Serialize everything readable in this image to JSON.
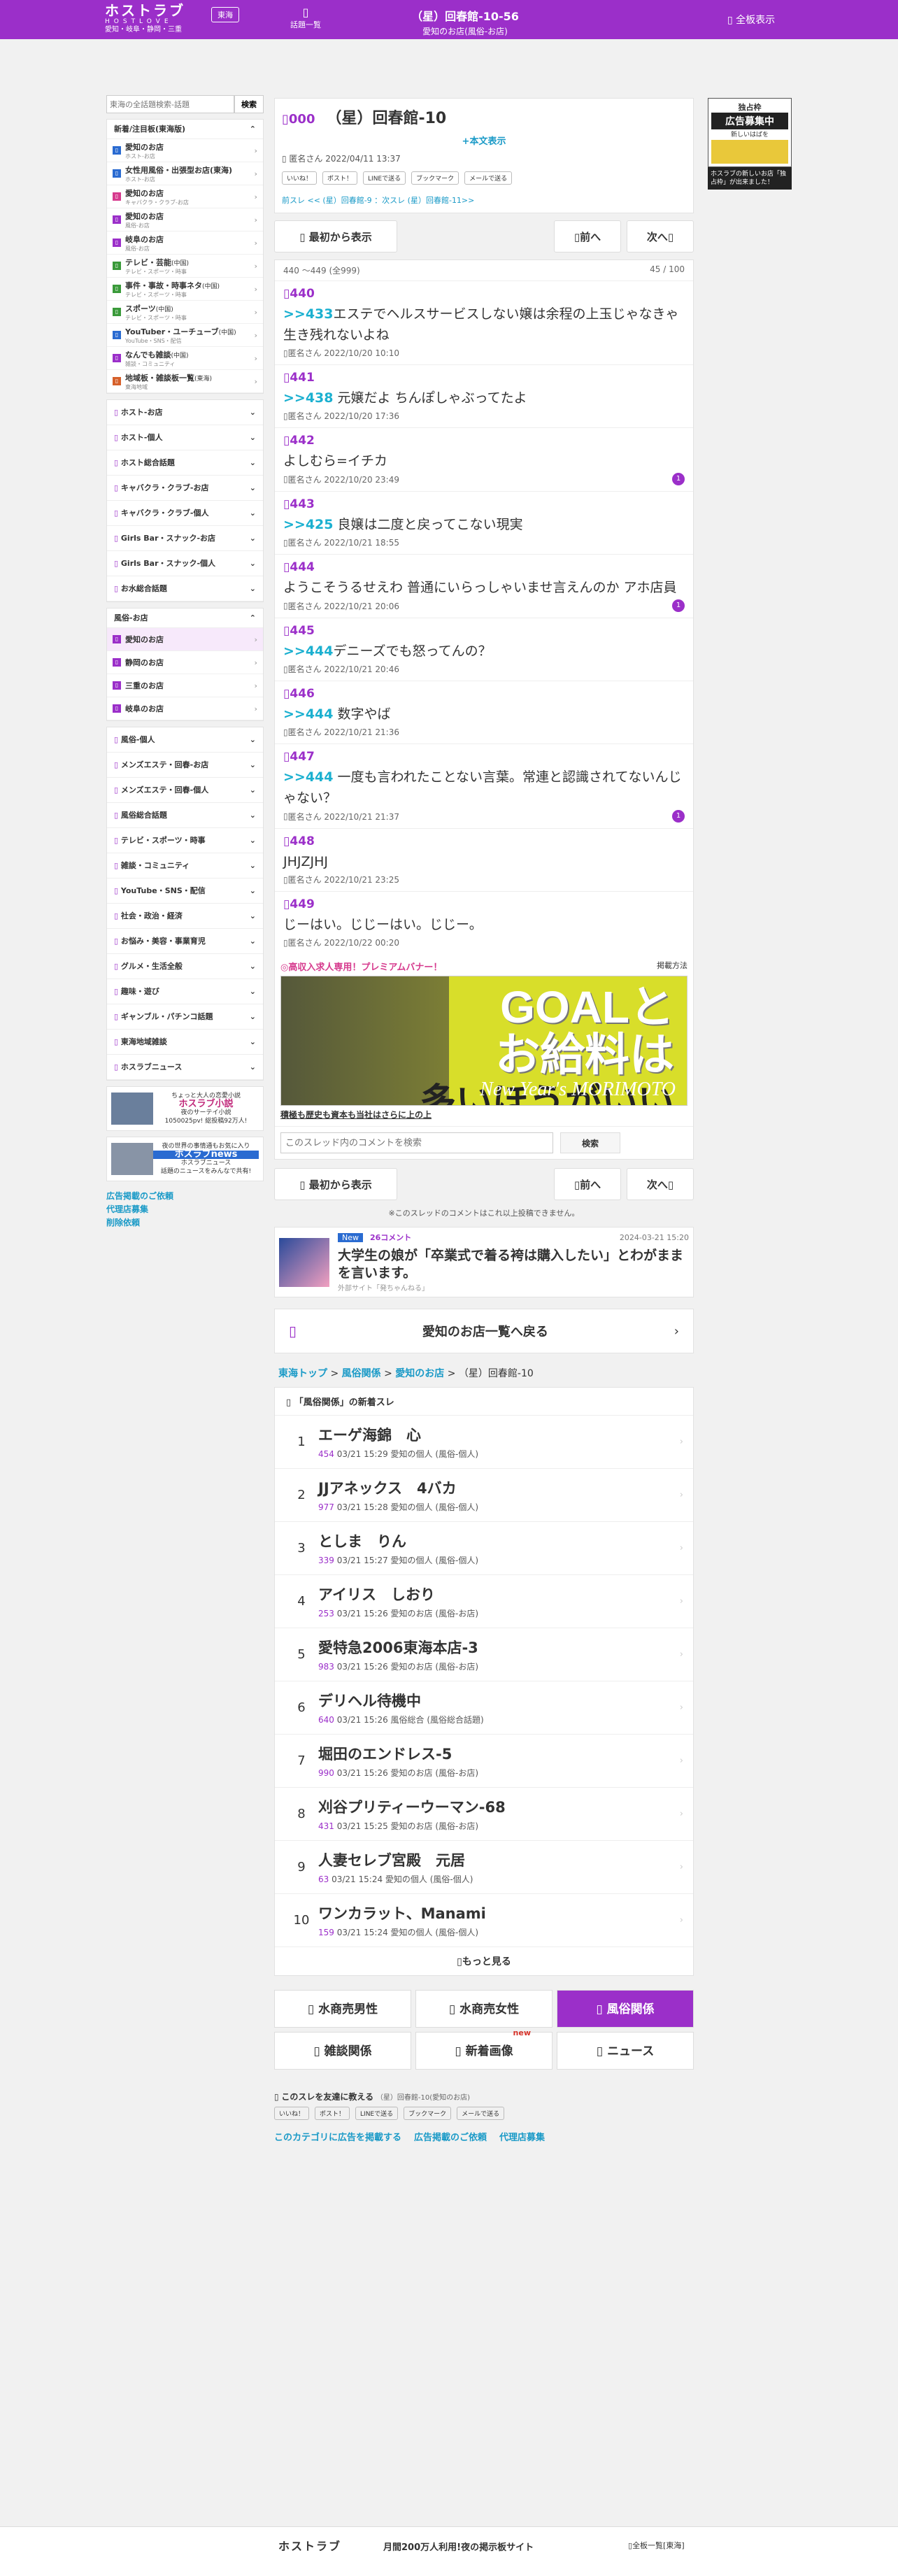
{
  "header": {
    "logo": "ホストラブ",
    "logo_en": "HOSTLOVE",
    "region_sub": "愛知・岐阜・静岡・三重",
    "area_button": "東海",
    "thread_list_label": "話題一覧",
    "title": "（星）回春館-10-56",
    "subtitle": "愛知のお店(風俗-お店)",
    "full_display": "全板表示"
  },
  "search": {
    "placeholder": "東海の全話題検索-話題",
    "button": "検索"
  },
  "sidebar": {
    "new_header": "新着/注目板(東海版)",
    "items": [
      {
        "label": "愛知のお店",
        "sub": "ホスト-お店",
        "color": "#2a6bd1"
      },
      {
        "label": "女性用風俗・出張型お店(東海)",
        "sub": "ホスト-お店",
        "color": "#2a6bd1"
      },
      {
        "label": "愛知のお店",
        "sub": "キャバクラ・クラブ-お店",
        "color": "#d63b8e"
      },
      {
        "label": "愛知のお店",
        "sub": "風俗-お店",
        "color": "#9b2fc9"
      },
      {
        "label": "岐阜のお店",
        "sub": "風俗-お店",
        "color": "#9b2fc9"
      },
      {
        "label": "テレビ・芸能",
        "tag": "(中国)",
        "sub": "テレビ・スポーツ・時事",
        "color": "#3a9a3a"
      },
      {
        "label": "事件・事故・時事ネタ",
        "tag": "(中国)",
        "sub": "テレビ・スポーツ・時事",
        "color": "#3a9a3a"
      },
      {
        "label": "スポーツ",
        "tag": "(中国)",
        "sub": "テレビ・スポーツ・時事",
        "color": "#3a9a3a"
      },
      {
        "label": "YouTuber・ユーチューブ",
        "tag": "(中国)",
        "sub": "YouTube・SNS・配信",
        "color": "#2a6bd1"
      },
      {
        "label": "なんでも雑談",
        "tag": "(中国)",
        "sub": "雑談・コミュニティ",
        "color": "#9b2fc9"
      },
      {
        "label": "地域板・雑談板一覧",
        "tag": "(東海)",
        "sub": "東海地域",
        "color": "#d6602a"
      }
    ],
    "groups1": [
      "ホスト-お店",
      "ホスト-個人",
      "ホスト総合話題",
      "キャバクラ・クラブ-お店",
      "キャバクラ・クラブ-個人",
      "Girls Bar・スナック-お店",
      "Girls Bar・スナック-個人",
      "お水総合話題"
    ],
    "fuzoku_header": "風俗-お店",
    "fuzoku_items": [
      "愛知のお店",
      "静岡のお店",
      "三重のお店",
      "岐阜のお店"
    ],
    "groups2": [
      "風俗-個人",
      "メンズエステ・回春-お店",
      "メンズエステ・回春-個人",
      "風俗総合話題",
      "テレビ・スポーツ・時事",
      "雑談・コミュニティ",
      "YouTube・SNS・配信",
      "社会・政治・経済",
      "お悩み・美容・事業育児",
      "グルメ・生活全般",
      "趣味・遊び",
      "ギャンブル・パチンコ話題",
      "東海地域雑談",
      "ホスラブニュース"
    ],
    "ad1": {
      "t1": "ちょっと大人の恋愛小説",
      "t2": "ホスラブ小説",
      "t3": "夜のサーテイ小説",
      "t4": "1050025pv! 総投稿92万人!"
    },
    "ad2": {
      "t1": "夜の世界の事情通もお気に入り",
      "t2": "ホスラブnews",
      "t3": "ホスラブニュース",
      "t4": "話題のニュースをみんなで共有!"
    },
    "links": [
      "広告掲載のご依頼",
      "代理店募集",
      "削除依頼"
    ]
  },
  "thread": {
    "no": "000",
    "title": "（星）回春館-10",
    "show_body": "+本文表示",
    "meta": "匿名さん 2022/04/11 13:37",
    "share": [
      "いいね！",
      "ポスト！",
      "LINEで送る",
      "ブックマーク",
      "メールで送る"
    ],
    "nav": "前スレ << (星）回春館-9 ：次スレ (星）回春館-11>>",
    "first": "最初から表示",
    "prev": "前へ",
    "next": "次へ",
    "range": "440 〜449 (全999)",
    "count": "45 / 100"
  },
  "posts": [
    {
      "no": "440",
      "anc": ">>433",
      "text": "エステでヘルスサービスしない嬢は余程の上玉じゃなきゃ生き残れないよね",
      "meta": "匿名さん 2022/10/20 10:10",
      "cnt": ""
    },
    {
      "no": "441",
      "anc": ">>438",
      "text": " 元嬢だよ ちんぽしゃぶってたよ",
      "meta": "匿名さん 2022/10/20 17:36",
      "cnt": ""
    },
    {
      "no": "442",
      "anc": "",
      "text": "よしむら=イチカ",
      "meta": "匿名さん 2022/10/20 23:49",
      "cnt": "1"
    },
    {
      "no": "443",
      "anc": ">>425",
      "text": " 良嬢は二度と戻ってこない現実",
      "meta": "匿名さん 2022/10/21 18:55",
      "cnt": ""
    },
    {
      "no": "444",
      "anc": "",
      "text": "ようこそうるせえわ 普通にいらっしゃいませ言えんのか アホ店員",
      "meta": "匿名さん 2022/10/21 20:06",
      "cnt": "1"
    },
    {
      "no": "445",
      "anc": ">>444",
      "text": "デニーズでも怒ってんの？",
      "meta": "匿名さん 2022/10/21 20:46",
      "cnt": ""
    },
    {
      "no": "446",
      "anc": ">>444",
      "text": " 数字やば",
      "meta": "匿名さん 2022/10/21 21:36",
      "cnt": ""
    },
    {
      "no": "447",
      "anc": ">>444",
      "text": " 一度も言われたことない言葉。常連と認識されてないんじゃない？",
      "meta": "匿名さん 2022/10/21 21:37",
      "cnt": "1"
    },
    {
      "no": "448",
      "anc": "",
      "text": "JHJZJHJ",
      "meta": "匿名さん 2022/10/21 23:25",
      "cnt": ""
    },
    {
      "no": "449",
      "anc": "",
      "text": "じーはい。じじーはい。じじー。",
      "meta": "匿名さん 2022/10/22 00:20",
      "cnt": ""
    }
  ],
  "banner": {
    "head": "◎高収入求人専用！プレミアムバナー！",
    "method": "掲載方法",
    "line1": "GOALと",
    "line2": "お給料は",
    "line3": "多いほうがいい",
    "small": "New Year's MORIMOTO",
    "caption": "積極も歴史も資本も当社はさらに上の上"
  },
  "comment_search": {
    "placeholder": "このスレッド内のコメントを検索",
    "button": "検索"
  },
  "closed_note": "※このスレッドのコメントはこれ以上投稿できません。",
  "news": {
    "badge": "New",
    "count": "26コメント",
    "date": "2024-03-21 15:20",
    "title": "大学生の娘が「卒業式で着る袴は購入したい」とわがままを言います。",
    "source": "外部サイト「発ちゃんねる」"
  },
  "back_label": "愛知のお店一覧へ戻る",
  "breadcrumb": [
    "東海トップ",
    "風俗関係",
    "愛知のお店",
    "（星）回春館-10"
  ],
  "new_threads": {
    "title": "「風俗関係」の新着スレ",
    "more": "もっと見る",
    "items": [
      {
        "rank": "1",
        "title": "エーゲ海錦　心",
        "count": "454",
        "time": "03/21 15:29",
        "board": "愛知の個人 (風俗-個人)"
      },
      {
        "rank": "2",
        "title": "JJアネックス　4バカ",
        "count": "977",
        "time": "03/21 15:28",
        "board": "愛知の個人 (風俗-個人)"
      },
      {
        "rank": "3",
        "title": "としま　りん",
        "count": "339",
        "time": "03/21 15:27",
        "board": "愛知の個人 (風俗-個人)"
      },
      {
        "rank": "4",
        "title": "アイリス　しおり",
        "count": "253",
        "time": "03/21 15:26",
        "board": "愛知のお店 (風俗-お店)"
      },
      {
        "rank": "5",
        "title": "愛特急2006東海本店-3",
        "count": "983",
        "time": "03/21 15:26",
        "board": "愛知のお店 (風俗-お店)"
      },
      {
        "rank": "6",
        "title": "デリヘル待機中",
        "count": "640",
        "time": "03/21 15:26",
        "board": "風俗総合 (風俗総合話題)"
      },
      {
        "rank": "7",
        "title": "堀田のエンドレス-5",
        "count": "990",
        "time": "03/21 15:26",
        "board": "愛知のお店 (風俗-お店)"
      },
      {
        "rank": "8",
        "title": "刈谷プリティーウーマン-68",
        "count": "431",
        "time": "03/21 15:25",
        "board": "愛知のお店 (風俗-お店)"
      },
      {
        "rank": "9",
        "title": "人妻セレブ宮殿　元居",
        "count": "63",
        "time": "03/21 15:24",
        "board": "愛知の個人 (風俗-個人)"
      },
      {
        "rank": "10",
        "title": "ワンカラット、Manami",
        "count": "159",
        "time": "03/21 15:24",
        "board": "愛知の個人 (風俗-個人)"
      }
    ]
  },
  "tabs": [
    {
      "label": "水商売男性",
      "active": false
    },
    {
      "label": "水商売女性",
      "active": false
    },
    {
      "label": "風俗関係",
      "active": true
    },
    {
      "label": "雑談関係",
      "active": false
    },
    {
      "label": "新着画像",
      "active": false,
      "badge": "new"
    },
    {
      "label": "ニュース",
      "active": false
    }
  ],
  "share_bottom": {
    "label": "このスレを友達に教える",
    "thread": "（星）回春館-10(愛知のお店)"
  },
  "bottom_links": [
    "このカテゴリに広告を掲載する",
    "広告掲載のご依頼",
    "代理店募集"
  ],
  "right_ad": {
    "t1": "独占枠",
    "t2": "広告募集中",
    "t3": "新しいはばを",
    "t4": "ホスラブの新しいお店「独占枠」が出来ました！"
  },
  "footer": {
    "logo": "ホストラブ",
    "tagline": "月間200万人利用!夜の掲示板サイト",
    "links": "全板一覧[東海]"
  }
}
